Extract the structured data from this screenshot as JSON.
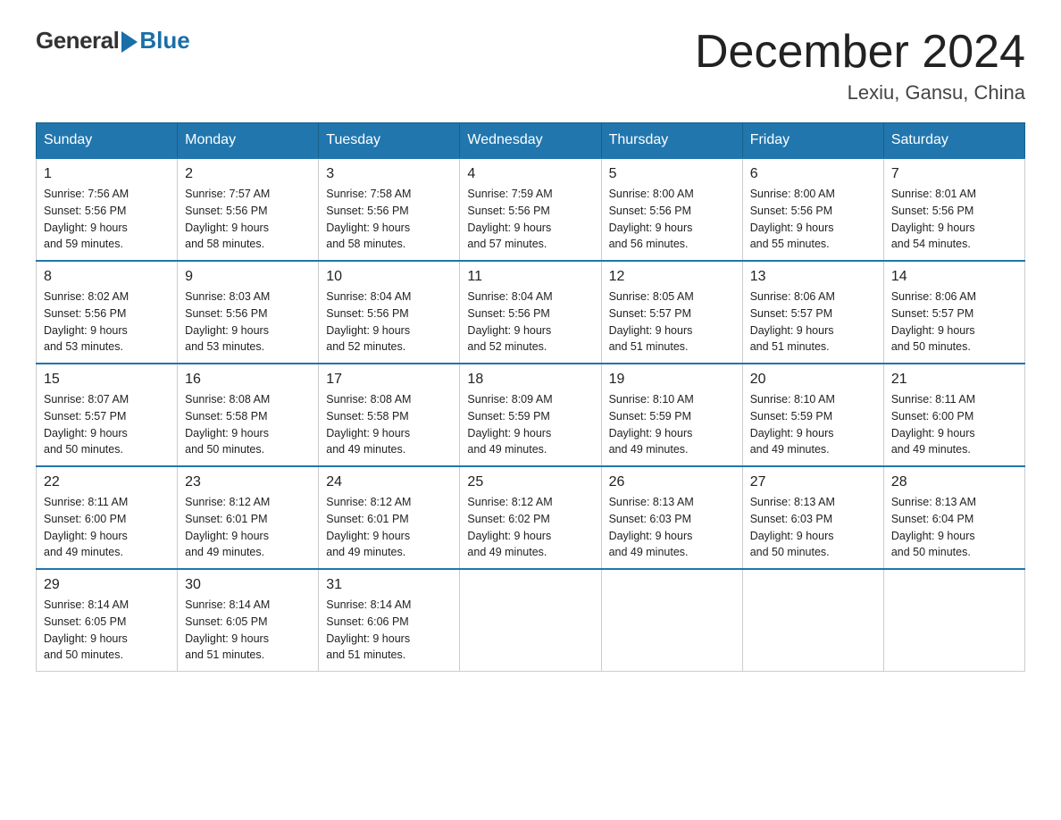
{
  "logo": {
    "general": "General",
    "blue": "Blue"
  },
  "title": "December 2024",
  "location": "Lexiu, Gansu, China",
  "weekdays": [
    "Sunday",
    "Monday",
    "Tuesday",
    "Wednesday",
    "Thursday",
    "Friday",
    "Saturday"
  ],
  "weeks": [
    [
      {
        "day": "1",
        "sunrise": "7:56 AM",
        "sunset": "5:56 PM",
        "daylight": "9 hours and 59 minutes."
      },
      {
        "day": "2",
        "sunrise": "7:57 AM",
        "sunset": "5:56 PM",
        "daylight": "9 hours and 58 minutes."
      },
      {
        "day": "3",
        "sunrise": "7:58 AM",
        "sunset": "5:56 PM",
        "daylight": "9 hours and 58 minutes."
      },
      {
        "day": "4",
        "sunrise": "7:59 AM",
        "sunset": "5:56 PM",
        "daylight": "9 hours and 57 minutes."
      },
      {
        "day": "5",
        "sunrise": "8:00 AM",
        "sunset": "5:56 PM",
        "daylight": "9 hours and 56 minutes."
      },
      {
        "day": "6",
        "sunrise": "8:00 AM",
        "sunset": "5:56 PM",
        "daylight": "9 hours and 55 minutes."
      },
      {
        "day": "7",
        "sunrise": "8:01 AM",
        "sunset": "5:56 PM",
        "daylight": "9 hours and 54 minutes."
      }
    ],
    [
      {
        "day": "8",
        "sunrise": "8:02 AM",
        "sunset": "5:56 PM",
        "daylight": "9 hours and 53 minutes."
      },
      {
        "day": "9",
        "sunrise": "8:03 AM",
        "sunset": "5:56 PM",
        "daylight": "9 hours and 53 minutes."
      },
      {
        "day": "10",
        "sunrise": "8:04 AM",
        "sunset": "5:56 PM",
        "daylight": "9 hours and 52 minutes."
      },
      {
        "day": "11",
        "sunrise": "8:04 AM",
        "sunset": "5:56 PM",
        "daylight": "9 hours and 52 minutes."
      },
      {
        "day": "12",
        "sunrise": "8:05 AM",
        "sunset": "5:57 PM",
        "daylight": "9 hours and 51 minutes."
      },
      {
        "day": "13",
        "sunrise": "8:06 AM",
        "sunset": "5:57 PM",
        "daylight": "9 hours and 51 minutes."
      },
      {
        "day": "14",
        "sunrise": "8:06 AM",
        "sunset": "5:57 PM",
        "daylight": "9 hours and 50 minutes."
      }
    ],
    [
      {
        "day": "15",
        "sunrise": "8:07 AM",
        "sunset": "5:57 PM",
        "daylight": "9 hours and 50 minutes."
      },
      {
        "day": "16",
        "sunrise": "8:08 AM",
        "sunset": "5:58 PM",
        "daylight": "9 hours and 50 minutes."
      },
      {
        "day": "17",
        "sunrise": "8:08 AM",
        "sunset": "5:58 PM",
        "daylight": "9 hours and 49 minutes."
      },
      {
        "day": "18",
        "sunrise": "8:09 AM",
        "sunset": "5:59 PM",
        "daylight": "9 hours and 49 minutes."
      },
      {
        "day": "19",
        "sunrise": "8:10 AM",
        "sunset": "5:59 PM",
        "daylight": "9 hours and 49 minutes."
      },
      {
        "day": "20",
        "sunrise": "8:10 AM",
        "sunset": "5:59 PM",
        "daylight": "9 hours and 49 minutes."
      },
      {
        "day": "21",
        "sunrise": "8:11 AM",
        "sunset": "6:00 PM",
        "daylight": "9 hours and 49 minutes."
      }
    ],
    [
      {
        "day": "22",
        "sunrise": "8:11 AM",
        "sunset": "6:00 PM",
        "daylight": "9 hours and 49 minutes."
      },
      {
        "day": "23",
        "sunrise": "8:12 AM",
        "sunset": "6:01 PM",
        "daylight": "9 hours and 49 minutes."
      },
      {
        "day": "24",
        "sunrise": "8:12 AM",
        "sunset": "6:01 PM",
        "daylight": "9 hours and 49 minutes."
      },
      {
        "day": "25",
        "sunrise": "8:12 AM",
        "sunset": "6:02 PM",
        "daylight": "9 hours and 49 minutes."
      },
      {
        "day": "26",
        "sunrise": "8:13 AM",
        "sunset": "6:03 PM",
        "daylight": "9 hours and 49 minutes."
      },
      {
        "day": "27",
        "sunrise": "8:13 AM",
        "sunset": "6:03 PM",
        "daylight": "9 hours and 50 minutes."
      },
      {
        "day": "28",
        "sunrise": "8:13 AM",
        "sunset": "6:04 PM",
        "daylight": "9 hours and 50 minutes."
      }
    ],
    [
      {
        "day": "29",
        "sunrise": "8:14 AM",
        "sunset": "6:05 PM",
        "daylight": "9 hours and 50 minutes."
      },
      {
        "day": "30",
        "sunrise": "8:14 AM",
        "sunset": "6:05 PM",
        "daylight": "9 hours and 51 minutes."
      },
      {
        "day": "31",
        "sunrise": "8:14 AM",
        "sunset": "6:06 PM",
        "daylight": "9 hours and 51 minutes."
      },
      null,
      null,
      null,
      null
    ]
  ],
  "labels": {
    "sunrise": "Sunrise: ",
    "sunset": "Sunset: ",
    "daylight": "Daylight: "
  }
}
